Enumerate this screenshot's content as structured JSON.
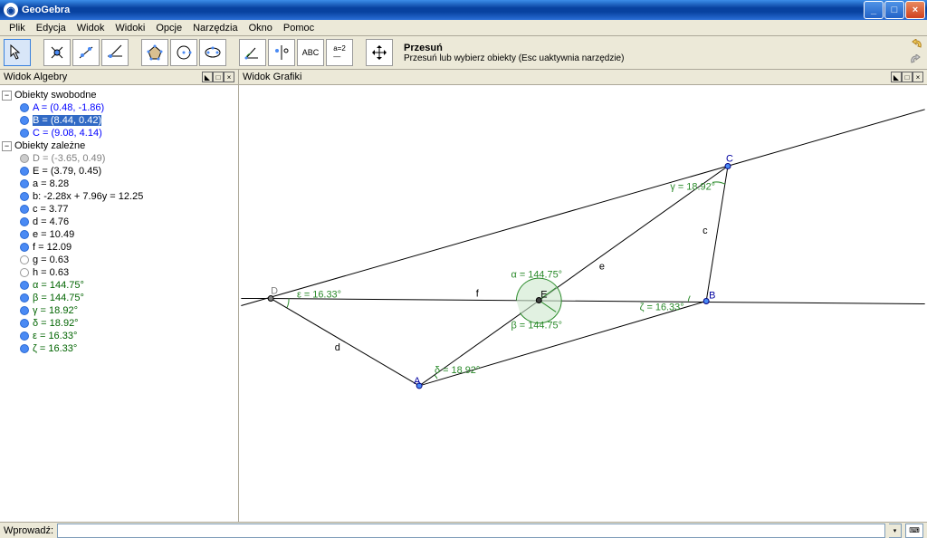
{
  "window": {
    "title": "GeoGebra"
  },
  "menu": {
    "items": [
      "Plik",
      "Edycja",
      "Widok",
      "Widoki",
      "Opcje",
      "Narzędzia",
      "Okno",
      "Pomoc"
    ]
  },
  "toolbar": {
    "desc_title": "Przesuń",
    "desc_text": "Przesuń lub wybierz obiekty (Esc uaktywnia narzędzie)"
  },
  "panels": {
    "algebra_title": "Widok Algebry",
    "graphics_title": "Widok Grafiki"
  },
  "tree": {
    "free": "Obiekty swobodne",
    "dep": "Obiekty zależne",
    "A": "A = (0.48, -1.86)",
    "B": "B = (8.44, 0.42)",
    "C": "C = (9.08, 4.14)",
    "D": "D = (-3.65, 0.49)",
    "E": "E = (3.79, 0.45)",
    "a": "a = 8.28",
    "b": "b: -2.28x + 7.96y = 12.25",
    "c": "c = 3.77",
    "d": "d = 4.76",
    "e": "e = 10.49",
    "f": "f = 12.09",
    "g": "g = 0.63",
    "h": "h = 0.63",
    "alpha": "α = 144.75°",
    "beta": "β = 144.75°",
    "gamma": "γ = 18.92°",
    "delta": "δ = 18.92°",
    "eps": "ε = 16.33°",
    "zeta": "ζ = 16.33°"
  },
  "canvas": {
    "pts": {
      "A": "A",
      "B": "B",
      "C": "C",
      "D": "D",
      "E": "E"
    },
    "edges": {
      "c": "c",
      "d": "d",
      "e": "e",
      "f": "f"
    },
    "angles": {
      "alpha": "α = 144.75°",
      "beta": "β = 144.75°",
      "gamma": "γ = 18.92°",
      "delta": "δ = 18.92°",
      "eps": "ε = 16.33°",
      "zeta": "ζ = 16.33°"
    }
  },
  "input": {
    "label": "Wprowadź:"
  }
}
